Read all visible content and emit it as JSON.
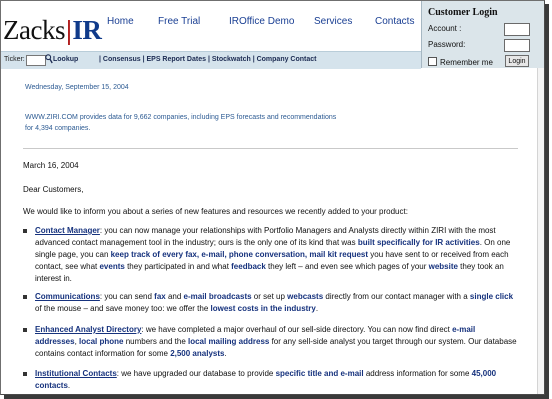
{
  "logo": {
    "left": "Zacks",
    "bar": "|",
    "right": "IR"
  },
  "nav": [
    {
      "label": "Home",
      "id": "nav-home"
    },
    {
      "label": "Free Trial",
      "id": "nav-free-trial"
    },
    {
      "label": "IROffice Demo",
      "id": "nav-iroffice-demo"
    },
    {
      "label": "Services",
      "id": "nav-services"
    },
    {
      "label": "Contacts",
      "id": "nav-contacts"
    }
  ],
  "toolbar": {
    "ticker_label": "Ticker:",
    "ticker_value": "",
    "lookup": "Lookup",
    "links": "| Consensus | EPS Report Dates | Stockwatch | Company Contact"
  },
  "login": {
    "title": "Customer Login",
    "account_label": "Account :",
    "password_label": "Password:",
    "remember_label": "Remember me",
    "login_button": "Login"
  },
  "content": {
    "date": "Wednesday, September 15, 2004",
    "provides": "WWW.ZIRI.COM provides data for 9,662 companies, including EPS forecasts and recommendations for 4,394 companies.",
    "letter_date": "March 16, 2004",
    "salutation": "Dear Customers,",
    "intro": "We would like to inform you about a series of new features and resources we recently added to your product:",
    "items": [
      {
        "title": "Contact Manager",
        "html": ":  you can now manage your relationships with Portfolio Managers and Analysts directly within ZIRI with the most advanced contact management tool in the industry; ours is the only one of its kind that was <b>built specifically for IR activities</b>. On one single page, you can <b>keep track of every fax, e-mail, phone conversation, mail kit request</b> you have sent to or received from each contact, see what <b>events</b> they participated in and what <b>feedback</b> they left – and even see which pages of your <b>website</b> they took an interest in."
      },
      {
        "title": "Communications",
        "html": ":  you can send <b>fax</b> and <b>e-mail broadcasts</b> or set up <b>webcasts</b> directly from our contact manager with a <b>single click</b> of the mouse – and save money too: we offer the <b>lowest costs in the industry</b>."
      },
      {
        "title": "Enhanced Analyst Directory",
        "html": ":  we have completed a major overhaul of our sell-side directory. You can now find direct <b>e-mail addresses</b>, <b>local phone</b> numbers and the <b>local mailing address</b> for any sell-side analyst you target through our system. Our database contains contact information for some <b>2,500 analysts</b>."
      },
      {
        "title": "Institutional Contacts",
        "html": ":  we have upgraded our database to provide <b>specific title and e-mail</b> address information for some <b>45,000 contacts</b>."
      }
    ]
  }
}
